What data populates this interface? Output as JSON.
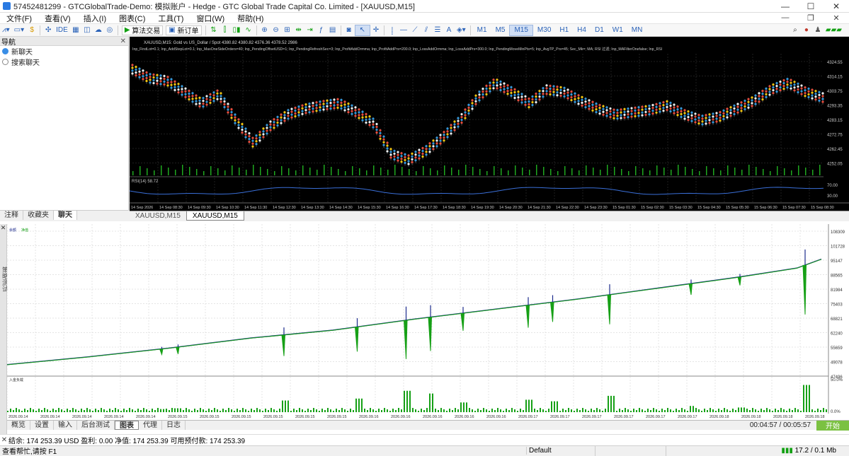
{
  "window": {
    "title": "57452481299 - GTCGlobalTrade-Demo: 模拟账户 - Hedge - GTC Global Trade Capital Co. Limited - [XAUUSD,M15]",
    "controls": [
      "—",
      "☐",
      "✕"
    ]
  },
  "menu": {
    "items": [
      "文件(F)",
      "查看(V)",
      "插入(I)",
      "图表(C)",
      "工具(T)",
      "窗口(W)",
      "帮助(H)"
    ],
    "mdi_controls": [
      "—",
      "❐",
      "✕"
    ]
  },
  "toolbar": {
    "ide_label": "IDE",
    "algo_label": "算法交易",
    "neworder_label": "新订单",
    "timeframes": [
      "M1",
      "M5",
      "M15",
      "M30",
      "H1",
      "H4",
      "D1",
      "W1",
      "MN"
    ],
    "active_timeframe": "M15"
  },
  "navigator": {
    "title": "导航",
    "items": [
      "新聊天",
      "搜索聊天"
    ],
    "tabs": [
      "注释",
      "收藏夹",
      "聊天"
    ],
    "active_tab": "聊天"
  },
  "chart": {
    "header": "XAUUSD,M15: Gold vs US_Dollar / Spot 4380.82 4380.82 4376.36 4378.52 2986",
    "params": "Inp_FirstLot=0.1; Inp_AddStepLot=0.1; Inp_MaxOneSideOrders=40; Inp_PendingOffsetUSD=1; Inp_PendingRefreshSec=3; Inp_ProfitAddOrmma; Inp_ProfitAddPrs=200.0; Inp_LossAddOrmma; Inp_LossAddPrs=300.0; Inp_PendingMoveMinPts=5; Inp_AvgTP_Prs=45; Sec_Mk=; MA; RSI 过滤; Inp_MAFilterOnefalse; Inp_RSI",
    "price_labels": [
      "4324.55",
      "4314.15",
      "4303.75",
      "4293.35",
      "4283.15",
      "4272.75",
      "4262.45",
      "4252.05"
    ],
    "rsi_label": "RSI(14) 58.72",
    "rsi_levels": [
      "70.00",
      "30.00"
    ],
    "time_labels": [
      "14 Sep 2026",
      "14 Sep 08:30",
      "14 Sep 09:30",
      "14 Sep 10:30",
      "14 Sep 11:30",
      "14 Sep 12:30",
      "14 Sep 13:30",
      "14 Sep 14:30",
      "14 Sep 15:30",
      "14 Sep 16:30",
      "14 Sep 17:30",
      "14 Sep 18:30",
      "14 Sep 19:30",
      "14 Sep 20:30",
      "14 Sep 21:30",
      "14 Sep 22:30",
      "14 Sep 23:30",
      "15 Sep 01:30",
      "15 Sep 02:30",
      "15 Sep 03:30",
      "15 Sep 04:30",
      "15 Sep 05:30",
      "15 Sep 06:30",
      "15 Sep 07:30",
      "15 Sep 08:30"
    ],
    "tabs": [
      "XAUUSD,M15",
      "XAUUSD,M15"
    ],
    "active_tab": 1
  },
  "tester": {
    "sidebar_label": "策略测试",
    "legend": [
      "余额",
      "净值"
    ],
    "load_label": "入金负载",
    "load_levels": [
      "50.0%",
      "0.0%"
    ],
    "price_labels": [
      "108309",
      "101728",
      "95147",
      "88565",
      "81984",
      "75403",
      "68821",
      "62240",
      "55659",
      "49078",
      "47496"
    ],
    "date_labels": [
      "2026.09.14",
      "2026.09.14",
      "2026.09.14",
      "2026.09.14",
      "2026.09.14",
      "2026.09.15",
      "2026.09.15",
      "2026.09.15",
      "2026.09.15",
      "2026.09.15",
      "2026.09.15",
      "2026.09.16",
      "2026.09.16",
      "2026.09.16",
      "2026.09.16",
      "2026.09.16",
      "2026.09.17",
      "2026.09.17",
      "2026.09.17",
      "2026.09.17",
      "2026.09.17",
      "2026.09.17",
      "2026.09.18",
      "2026.09.18",
      "2026.09.18",
      "2026.09.18"
    ],
    "tabs": [
      "概览",
      "设置",
      "输入",
      "后台测试",
      "图表",
      "代理",
      "日志"
    ],
    "active_tab": "图表",
    "timer": "00:04:57 / 00:05:57",
    "start_label": "开始"
  },
  "chart_data": {
    "type": "line",
    "ylim": [
      47496,
      108309
    ],
    "series": [
      {
        "name": "余额",
        "color": "#1c2a8c",
        "x": [
          0,
          0.1,
          0.2,
          0.3,
          0.4,
          0.5,
          0.6,
          0.7,
          0.8,
          0.9,
          0.97,
          1.0
        ],
        "values": [
          49500,
          53000,
          57000,
          61500,
          65000,
          70000,
          74500,
          79000,
          84000,
          89000,
          93000,
          97000
        ]
      },
      {
        "name": "净值",
        "color": "#16a016",
        "x": [
          0,
          0.1,
          0.2,
          0.3,
          0.4,
          0.5,
          0.6,
          0.7,
          0.8,
          0.9,
          0.97,
          1.0
        ],
        "values": [
          49400,
          52900,
          56900,
          61400,
          64900,
          69900,
          74400,
          78900,
          83900,
          88900,
          92900,
          96900
        ]
      }
    ]
  },
  "account": {
    "text": "结余: 174 253.39 USD  盈利: 0.00  净值: 174 253.39  可用预付款: 174 253.39"
  },
  "status": {
    "help": "查看帮忙,请按 F1",
    "profile": "Default",
    "traffic": "17.2 / 0.1 Mb"
  }
}
